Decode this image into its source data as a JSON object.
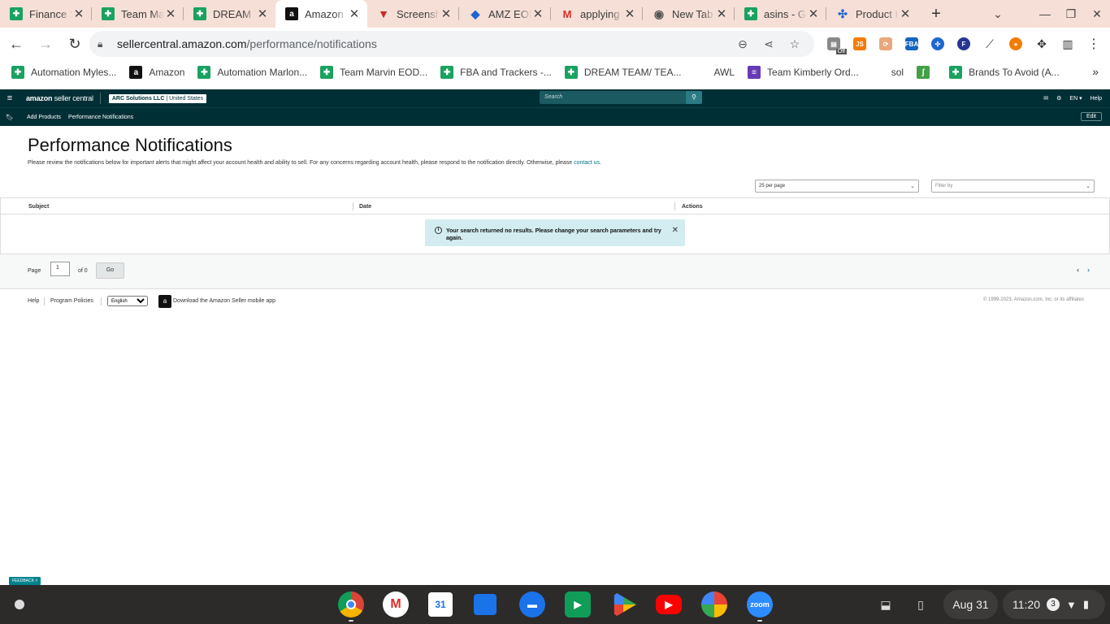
{
  "browser": {
    "tabs": [
      {
        "title": "Finance S",
        "icon": "sheets-icon"
      },
      {
        "title": "Team Ma",
        "icon": "sheets-icon"
      },
      {
        "title": "DREAM T",
        "icon": "sheets-icon"
      },
      {
        "title": "Amazon",
        "icon": "amazon-icon",
        "active": true
      },
      {
        "title": "Screensh",
        "icon": "screenshot-icon"
      },
      {
        "title": "AMZ EOD",
        "icon": "app-icon"
      },
      {
        "title": "applying",
        "icon": "gmail-icon"
      },
      {
        "title": "New Tab",
        "icon": "chrome-icon"
      },
      {
        "title": "asins - Go",
        "icon": "sheets-icon"
      },
      {
        "title": "Product I",
        "icon": "product-icon"
      }
    ],
    "url_host": "sellercentral.amazon.com",
    "url_path": "/performance/notifications",
    "extension_badge": "Off",
    "bookmarks": [
      {
        "label": "Automation Myles...",
        "icon": "sheets-icon"
      },
      {
        "label": "Amazon",
        "icon": "amazon-icon"
      },
      {
        "label": "Automation Marlon...",
        "icon": "sheets-icon"
      },
      {
        "label": "Team Marvin EOD...",
        "icon": "sheets-icon"
      },
      {
        "label": "FBA and Trackers -...",
        "icon": "sheets-icon"
      },
      {
        "label": "DREAM TEAM/ TEA...",
        "icon": "sheets-icon"
      },
      {
        "label": "AWL",
        "icon": "awl-icon"
      },
      {
        "label": "Team Kimberly Ord...",
        "icon": "forms-icon"
      },
      {
        "label": "sol",
        "icon": "gmail-icon"
      },
      {
        "label": "",
        "icon": "green-logo-icon"
      },
      {
        "label": "Brands To Avoid (A...",
        "icon": "sheets-icon"
      }
    ]
  },
  "seller_central": {
    "logo_bold": "amazon",
    "logo_light": " seller central",
    "account_name": "ARC Solutions LLC",
    "account_region": " | United States",
    "search_placeholder": "Search",
    "lang": "EN ▾",
    "help": "Help",
    "sub_links": [
      "Add Products",
      "Performance Notifications"
    ],
    "edit": "Edit"
  },
  "page": {
    "title": "Performance Notifications",
    "description": "Please review the notifications below for important alerts that might affect your account health and ability to sell. For any concerns regarding account health, please respond to the notification directly. Otherwise, please ",
    "contact_link": "contact us",
    "description_end": ".",
    "per_page": "25 per page",
    "filter_placeholder": "Filter by",
    "columns": [
      "Subject",
      "Date",
      "Actions"
    ],
    "empty_message": "Your search returned no results. Please change your search parameters and try again.",
    "pager_label": "Page",
    "pager_value": "1",
    "pager_of": "of 0",
    "go": "Go"
  },
  "footer": {
    "help": "Help",
    "policies": "Program Policies",
    "language": "English",
    "app_text": "Download the Amazon Seller mobile app",
    "copyright": "© 1999-2023, Amazon.com, Inc. or its affiliates"
  },
  "feedback": "FEEDBACK ×",
  "os": {
    "date": "Aug 31",
    "time": "11:20",
    "notif_count": "3",
    "shelf_apps": [
      "chrome-icon",
      "gmail-icon",
      "calendar-icon",
      "files-icon",
      "messages-icon",
      "meet-icon",
      "play-store-icon",
      "youtube-icon",
      "photos-icon",
      "zoom-icon"
    ],
    "zoom_label": "zoom"
  }
}
